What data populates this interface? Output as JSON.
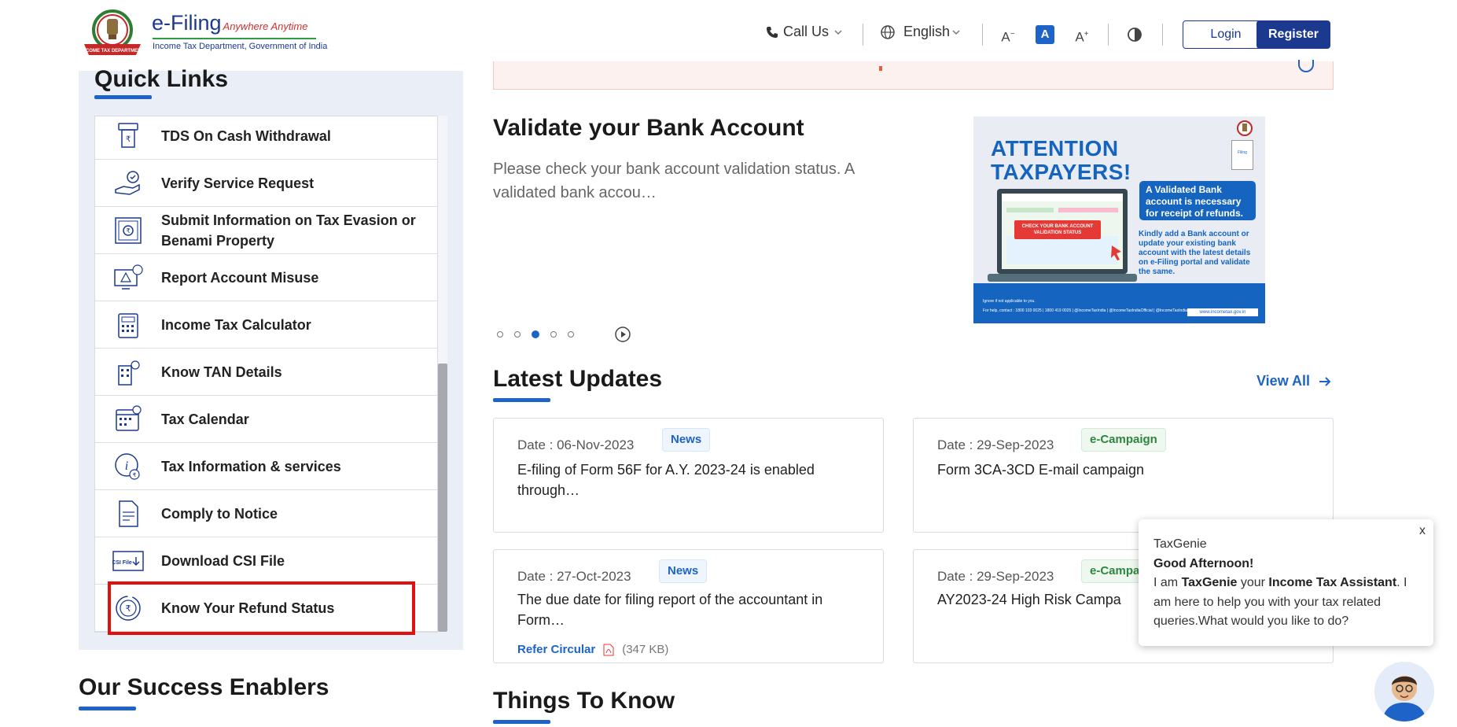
{
  "header": {
    "brand_main": "e-Filing",
    "brand_tagline": "Anywhere Anytime",
    "brand_sub": "Income Tax Department, Government of India",
    "call_us": "Call Us",
    "language": "English",
    "font_decrease": "A",
    "font_normal": "A",
    "font_increase": "A",
    "login": "Login",
    "register": "Register"
  },
  "quick_links": {
    "title": "Quick Links",
    "items": [
      {
        "label": "TDS On Cash Withdrawal",
        "icon": "atm-icon"
      },
      {
        "label": "Verify Service Request",
        "icon": "verify-hand-icon"
      },
      {
        "label": "Submit Information on Tax Evasion or Benami Property",
        "icon": "safe-icon"
      },
      {
        "label": "Report Account Misuse",
        "icon": "alert-monitor-icon"
      },
      {
        "label": "Income Tax Calculator",
        "icon": "calculator-icon"
      },
      {
        "label": "Know TAN Details",
        "icon": "building-icon"
      },
      {
        "label": "Tax Calendar",
        "icon": "calendar-icon"
      },
      {
        "label": "Tax Information & services",
        "icon": "info-icon"
      },
      {
        "label": "Comply to Notice",
        "icon": "document-icon"
      },
      {
        "label": "Download CSI File",
        "icon": "csi-file-icon"
      },
      {
        "label": "Know Your Refund Status",
        "icon": "rupee-refund-icon"
      }
    ]
  },
  "success_enablers": {
    "title": "Our Success Enablers"
  },
  "promo": {
    "title": "Validate your Bank Account",
    "description": "Please check your bank account validation status. A validated bank accou…",
    "banner": {
      "headline_1": "ATTENTION",
      "headline_2": "TAXPAYERS!",
      "box_text": "A Validated Bank account is necessary for receipt of refunds.",
      "body_text": "Kindly add a Bank account or update your existing bank account with the latest details on e-Filing portal and validate the same.",
      "screen_button": "CHECK YOUR BANK ACCOUNT VALIDATION STATUS",
      "foot_1": "Ignore if not applicable to you.",
      "foot_2": "For help, contact : 1800 103 0025 | 1800 419 0025 | @IncomeTaxIndia | @IncomeTaxIndiaOfficial | @IncomeTaxIndia",
      "website": "www.incometax.gov.in",
      "form_label": "Filing"
    },
    "slides_total": 5,
    "active_slide": 3
  },
  "latest_updates": {
    "title": "Latest Updates",
    "view_all": "View All",
    "cards": [
      {
        "date": "Date : 06-Nov-2023",
        "badge": "News",
        "text": "E-filing of Form 56F for A.Y. 2023-24 is enabled through…"
      },
      {
        "date": "Date : 29-Sep-2023",
        "badge": "e-Campaign",
        "text": "Form 3CA-3CD E-mail campaign"
      },
      {
        "date": "Date : 27-Oct-2023",
        "badge": "News",
        "text": "The due date for filing report of the accountant in Form…",
        "link": "Refer Circular",
        "size": "(347 KB)"
      },
      {
        "date": "Date : 29-Sep-2023",
        "badge": "e-Campai",
        "text": "AY2023-24 High Risk Campa"
      }
    ]
  },
  "things_to_know": {
    "title": "Things To Know"
  },
  "taxgenie": {
    "close": "x",
    "name": "TaxGenie",
    "greeting": "Good Afternoon!",
    "msg_1": "I am ",
    "msg_name": "TaxGenie",
    "msg_2": " your ",
    "msg_role": "Income Tax Assistant",
    "msg_3": ". I am here to help you with your tax related queries.What would you like to do?"
  },
  "colors": {
    "brand": "#1b3a8f",
    "accent": "#1e63c8",
    "highlight": "#e01010",
    "panel": "#eaeef6"
  }
}
